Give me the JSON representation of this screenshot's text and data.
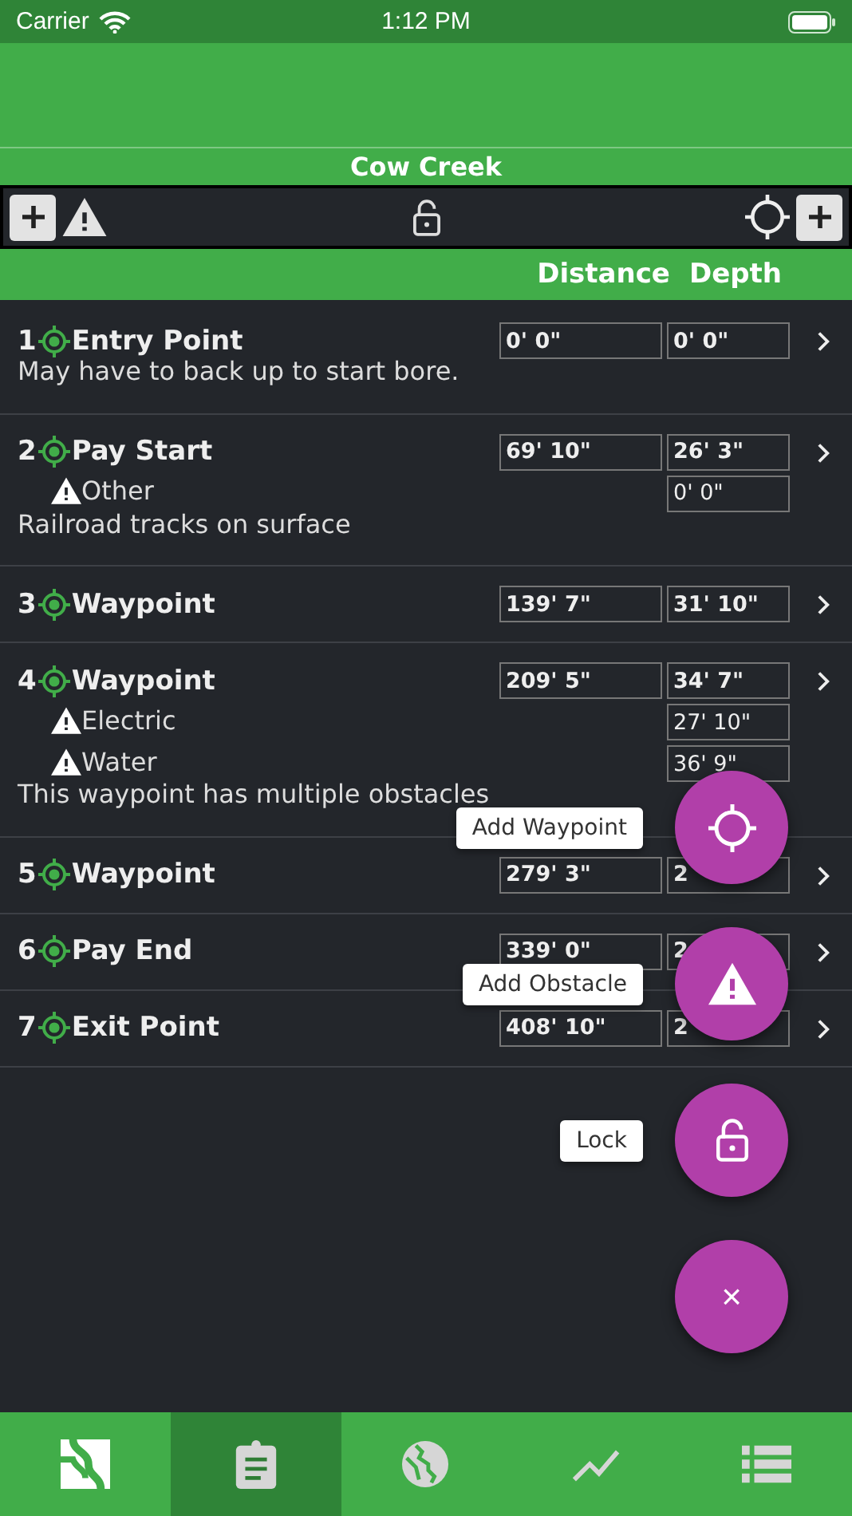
{
  "status_bar": {
    "carrier": "Carrier",
    "time": "1:12 PM"
  },
  "title": "Cow Creek",
  "columns": [
    "Distance",
    "Depth"
  ],
  "rows": [
    {
      "number": "1",
      "name": "Entry Point",
      "distance": "0' 0\"",
      "depths": [
        "0' 0\""
      ],
      "obstacles": [],
      "note": "May have to back up to start bore."
    },
    {
      "number": "2",
      "name": "Pay Start",
      "distance": "69' 10\"",
      "depths": [
        "26' 3\"",
        "0' 0\""
      ],
      "obstacles": [
        "Other"
      ],
      "note": "Railroad tracks on surface"
    },
    {
      "number": "3",
      "name": "Waypoint",
      "distance": "139' 7\"",
      "depths": [
        "31' 10\""
      ],
      "obstacles": []
    },
    {
      "number": "4",
      "name": "Waypoint",
      "distance": "209' 5\"",
      "depths": [
        "34' 7\"",
        "27' 10\"",
        "36' 9\""
      ],
      "obstacles": [
        "Electric",
        "Water"
      ],
      "note": "This waypoint has multiple obstacles"
    },
    {
      "number": "5",
      "name": "Waypoint",
      "distance": "279' 3\"",
      "depths": [
        "2"
      ],
      "obstacles": []
    },
    {
      "number": "6",
      "name": "Pay End",
      "distance": "339' 0\"",
      "depths": [
        "2"
      ],
      "obstacles": []
    },
    {
      "number": "7",
      "name": "Exit Point",
      "distance": "408' 10\"",
      "depths": [
        "2"
      ],
      "obstacles": []
    }
  ],
  "fab_menu": [
    {
      "kind": "waypoint",
      "label": "Add Waypoint"
    },
    {
      "kind": "obstacle",
      "label": "Add Obstacle"
    },
    {
      "kind": "lock",
      "label": "Lock"
    },
    {
      "kind": "close",
      "symbol": "×"
    }
  ],
  "tabs": [
    {
      "kind": "logo",
      "selected": false
    },
    {
      "kind": "clipboard",
      "selected": true
    },
    {
      "kind": "globe",
      "selected": false
    },
    {
      "kind": "chart",
      "selected": false
    },
    {
      "kind": "list",
      "selected": false
    }
  ]
}
